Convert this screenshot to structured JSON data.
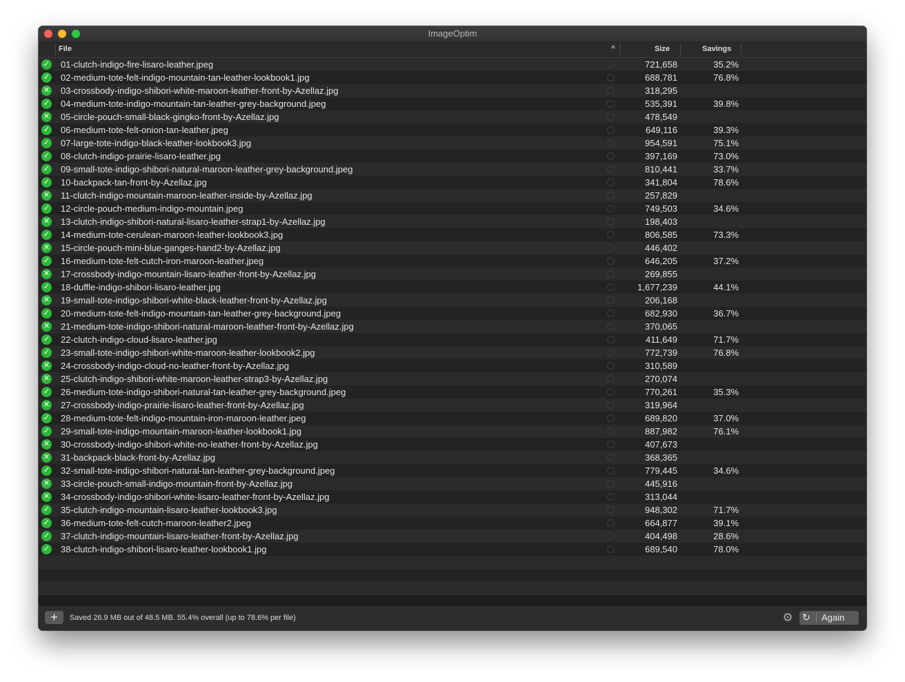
{
  "window": {
    "title": "ImageOptim"
  },
  "table": {
    "headers": {
      "file": "File",
      "size": "Size",
      "savings": "Savings"
    },
    "sort_indicator": "^",
    "rows": [
      {
        "status": "ok",
        "file": "01-clutch-indigo-fire-lisaro-leather.jpeg",
        "size": "721,658",
        "savings": "35.2%"
      },
      {
        "status": "ok",
        "file": "02-medium-tote-felt-indigo-mountain-tan-leather-lookbook1.jpg",
        "size": "688,781",
        "savings": "76.8%"
      },
      {
        "status": "skip",
        "file": "03-crossbody-indigo-shibori-white-maroon-leather-front-by-Azellaz.jpg",
        "size": "318,295",
        "savings": ""
      },
      {
        "status": "ok",
        "file": "04-medium-tote-indigo-mountain-tan-leather-grey-background.jpeg",
        "size": "535,391",
        "savings": "39.8%"
      },
      {
        "status": "skip",
        "file": "05-circle-pouch-small-black-gingko-front-by-Azellaz.jpg",
        "size": "478,549",
        "savings": ""
      },
      {
        "status": "ok",
        "file": "06-medium-tote-felt-onion-tan-leather.jpeg",
        "size": "649,116",
        "savings": "39.3%"
      },
      {
        "status": "ok",
        "file": "07-large-tote-indigo-black-leather-lookbook3.jpg",
        "size": "954,591",
        "savings": "75.1%"
      },
      {
        "status": "ok",
        "file": "08-clutch-indigo-prairie-lisaro-leather.jpg",
        "size": "397,169",
        "savings": "73.0%"
      },
      {
        "status": "ok",
        "file": "09-small-tote-indigo-shibori-natural-maroon-leather-grey-background.jpeg",
        "size": "810,441",
        "savings": "33.7%"
      },
      {
        "status": "ok",
        "file": "10-backpack-tan-front-by-Azellaz.jpg",
        "size": "341,804",
        "savings": "78.6%"
      },
      {
        "status": "skip",
        "file": "11-clutch-indigo-mountain-maroon-leather-inside-by-Azellaz.jpg",
        "size": "257,829",
        "savings": ""
      },
      {
        "status": "ok",
        "file": "12-circle-pouch-medium-indigo-mountain.jpeg",
        "size": "749,503",
        "savings": "34.6%"
      },
      {
        "status": "skip",
        "file": "13-clutch-indigo-shibori-natural-lisaro-leather-strap1-by-Azellaz.jpg",
        "size": "198,403",
        "savings": ""
      },
      {
        "status": "ok",
        "file": "14-medium-tote-cerulean-maroon-leather-lookbook3.jpg",
        "size": "806,585",
        "savings": "73.3%"
      },
      {
        "status": "skip",
        "file": "15-circle-pouch-mini-blue-ganges-hand2-by-Azellaz.jpg",
        "size": "446,402",
        "savings": ""
      },
      {
        "status": "ok",
        "file": "16-medium-tote-felt-cutch-iron-maroon-leather.jpeg",
        "size": "646,205",
        "savings": "37.2%"
      },
      {
        "status": "skip",
        "file": "17-crossbody-indigo-mountain-lisaro-leather-front-by-Azellaz.jpg",
        "size": "269,855",
        "savings": ""
      },
      {
        "status": "ok",
        "file": "18-duffle-indigo-shibori-lisaro-leather.jpg",
        "size": "1,677,239",
        "savings": "44.1%"
      },
      {
        "status": "skip",
        "file": "19-small-tote-indigo-shibori-white-black-leather-front-by-Azellaz.jpg",
        "size": "206,168",
        "savings": ""
      },
      {
        "status": "ok",
        "file": "20-medium-tote-felt-indigo-mountain-tan-leather-grey-background.jpeg",
        "size": "682,930",
        "savings": "36.7%"
      },
      {
        "status": "skip",
        "file": "21-medium-tote-indigo-shibori-natural-maroon-leather-front-by-Azellaz.jpg",
        "size": "370,065",
        "savings": ""
      },
      {
        "status": "ok",
        "file": "22-clutch-indigo-cloud-lisaro-leather.jpg",
        "size": "411,649",
        "savings": "71.7%"
      },
      {
        "status": "ok",
        "file": "23-small-tote-indigo-shibori-white-maroon-leather-lookbook2.jpg",
        "size": "772,739",
        "savings": "76.8%"
      },
      {
        "status": "skip",
        "file": "24-crossbody-indigo-cloud-no-leather-front-by-Azellaz.jpg",
        "size": "310,589",
        "savings": ""
      },
      {
        "status": "skip",
        "file": "25-clutch-indigo-shibori-white-maroon-leather-strap3-by-Azellaz.jpg",
        "size": "270,074",
        "savings": ""
      },
      {
        "status": "ok",
        "file": "26-medium-tote-indigo-shibori-natural-tan-leather-grey-background.jpeg",
        "size": "770,261",
        "savings": "35.3%"
      },
      {
        "status": "skip",
        "file": "27-crossbody-indigo-prairie-lisaro-leather-front-by-Azellaz.jpg",
        "size": "319,964",
        "savings": ""
      },
      {
        "status": "ok",
        "file": "28-medium-tote-felt-indigo-mountain-iron-maroon-leather.jpeg",
        "size": "689,820",
        "savings": "37.0%"
      },
      {
        "status": "ok",
        "file": "29-small-tote-indigo-mountain-maroon-leather-lookbook1.jpg",
        "size": "887,982",
        "savings": "76.1%"
      },
      {
        "status": "skip",
        "file": "30-crossbody-indigo-shibori-white-no-leather-front-by-Azellaz.jpg",
        "size": "407,673",
        "savings": ""
      },
      {
        "status": "skip",
        "file": "31-backpack-black-front-by-Azellaz.jpg",
        "size": "368,365",
        "savings": ""
      },
      {
        "status": "ok",
        "file": "32-small-tote-indigo-shibori-natural-tan-leather-grey-background.jpeg",
        "size": "779,445",
        "savings": "34.6%"
      },
      {
        "status": "skip",
        "file": "33-circle-pouch-small-indigo-mountain-front-by-Azellaz.jpg",
        "size": "445,916",
        "savings": ""
      },
      {
        "status": "skip",
        "file": "34-crossbody-indigo-shibori-white-lisaro-leather-front-by-Azellaz.jpg",
        "size": "313,044",
        "savings": ""
      },
      {
        "status": "ok",
        "file": "35-clutch-indigo-mountain-lisaro-leather-lookbook3.jpg",
        "size": "948,302",
        "savings": "71.7%"
      },
      {
        "status": "ok",
        "file": "36-medium-tote-felt-cutch-maroon-leather2.jpeg",
        "size": "664,877",
        "savings": "39.1%"
      },
      {
        "status": "ok",
        "file": "37-clutch-indigo-mountain-lisaro-leather-front-by-Azellaz.jpg",
        "size": "404,498",
        "savings": "28.6%"
      },
      {
        "status": "ok",
        "file": "38-clutch-indigo-shibori-lisaro-leather-lookbook1.jpg",
        "size": "689,540",
        "savings": "78.0%"
      }
    ]
  },
  "icons": {
    "ok": "checkmark-icon",
    "skip": "cross-icon",
    "reveal": "magnifier-icon"
  },
  "colors": {
    "status_green": "#2db839",
    "close": "#fe5f57",
    "minimize": "#febc2e",
    "maximize": "#28c840"
  },
  "footer": {
    "add_label": "+",
    "status": "Saved 26.9 MB out of 48.5 MB. 55.4% overall (up to 78.6% per file)",
    "again_label": "Again"
  }
}
